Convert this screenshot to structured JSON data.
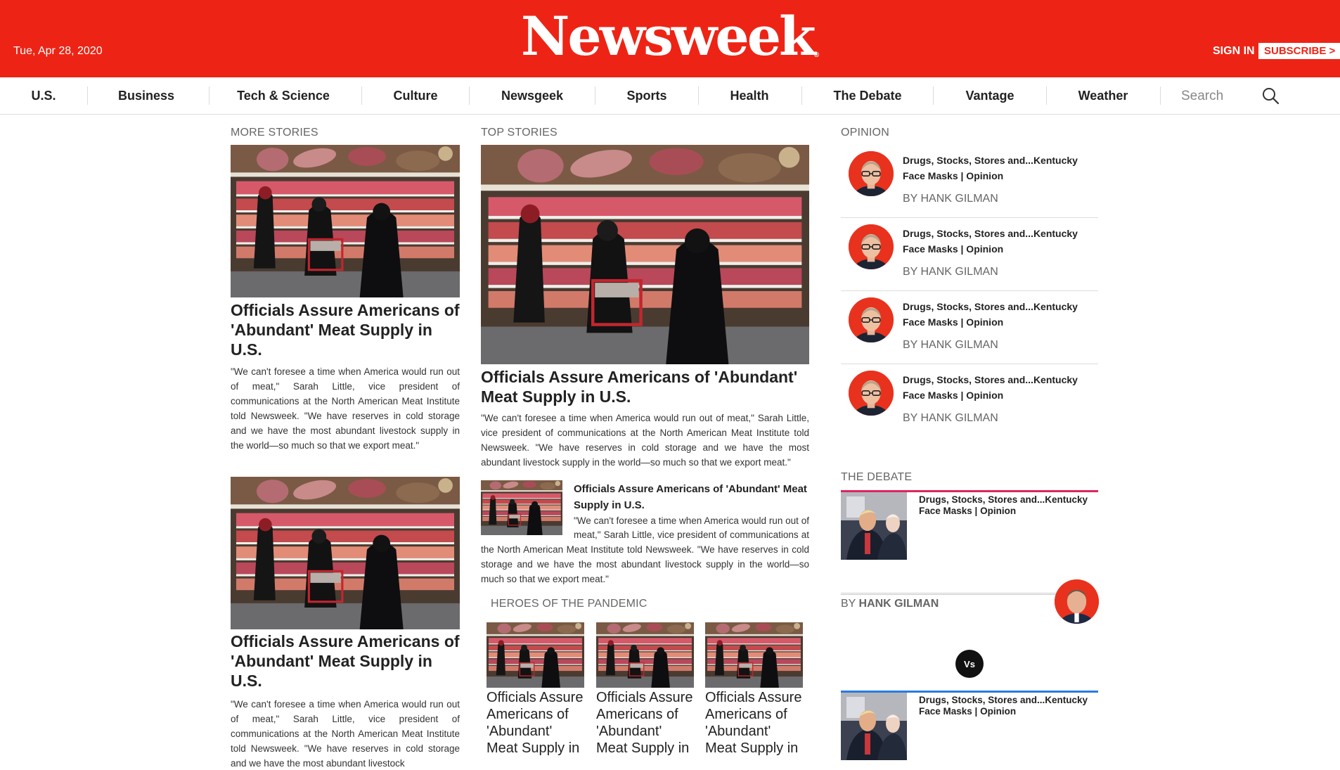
{
  "header": {
    "date": "Tue, Apr 28, 2020",
    "logo": "Newsweek",
    "signin": "SIGN IN",
    "subscribe": "SUBSCRIBE >"
  },
  "nav": {
    "items": [
      "U.S.",
      "Business",
      "Tech & Science",
      "Culture",
      "Newsgeek",
      "Sports",
      "Health",
      "The Debate",
      "Vantage",
      "Weather"
    ],
    "search_placeholder": "Search"
  },
  "more_stories": {
    "label": "MORE STORIES",
    "articles": [
      {
        "headline": "Officials Assure Americans of 'Abundant' Meat Supply in U.S.",
        "summary": "\"We can't foresee a time when America would run out of meat,\" Sarah Little, vice president of communications at the North American Meat Institute told Newsweek. \"We have reserves in cold storage and we have the most abundant livestock supply in the world—so much so that we export meat.\""
      },
      {
        "headline": "Officials Assure Americans of 'Abundant' Meat Supply in U.S.",
        "summary": "\"We can't foresee a time when America would run out of meat,\" Sarah Little, vice president of communications at the North American Meat Institute told Newsweek. \"We have reserves in cold storage and we have the most abundant livestock"
      }
    ]
  },
  "top_stories": {
    "label": "TOP STORIES",
    "lead": {
      "headline": "Officials Assure Americans of 'Abundant' Meat Supply in U.S.",
      "summary": "\"We can't foresee a time when America would run out of meat,\" Sarah Little, vice president of communications at the North American Meat Institute told Newsweek. \"We have reserves in cold storage and we have the most abundant livestock supply in the world—so much so that we export meat.\""
    },
    "secondary": {
      "headline": "Officials Assure Americans of 'Abundant' Meat Supply in U.S.",
      "summary": "\"We can't foresee a time when America would run out of meat,\" Sarah Little, vice president of communications at the North American Meat Institute told Newsweek. \"We have reserves in cold storage and we have the most abundant livestock supply in the world—so much so that we export meat.\""
    },
    "heroes": {
      "label": "HEROES OF THE PANDEMIC",
      "items": [
        {
          "headline": "Officials Assure Americans of 'Abundant' Meat Supply in"
        },
        {
          "headline": "Officials Assure Americans of 'Abundant' Meat Supply in"
        },
        {
          "headline": "Officials Assure Americans of 'Abundant' Meat Supply in"
        }
      ]
    }
  },
  "opinion": {
    "label": "OPINION",
    "items": [
      {
        "title": "Drugs, Stocks, Stores and...Kentucky Face Masks | Opinion",
        "byline": "BY HANK GILMAN"
      },
      {
        "title": "Drugs, Stocks, Stores and...Kentucky Face Masks | Opinion",
        "byline": "BY HANK GILMAN"
      },
      {
        "title": "Drugs, Stocks, Stores and...Kentucky Face Masks | Opinion",
        "byline": "BY HANK GILMAN"
      },
      {
        "title": "Drugs, Stocks, Stores and...Kentucky Face Masks | Opinion",
        "byline": "BY HANK GILMAN"
      }
    ]
  },
  "debate": {
    "label": "THE DEBATE",
    "top": {
      "title": "Drugs, Stocks, Stores and...Kentucky Face Masks | Opinion",
      "accent": "#e0245e"
    },
    "by_prefix": "BY",
    "author": "HANK GILMAN",
    "vs": "Vs",
    "bottom": {
      "title": "Drugs, Stocks, Stores and...Kentucky Face Masks | Opinion",
      "accent": "#2a7ae2"
    }
  },
  "colors": {
    "brand_red": "#ed2415"
  },
  "icons": {
    "search": "search-icon",
    "photo": "photo-thumbnail"
  }
}
